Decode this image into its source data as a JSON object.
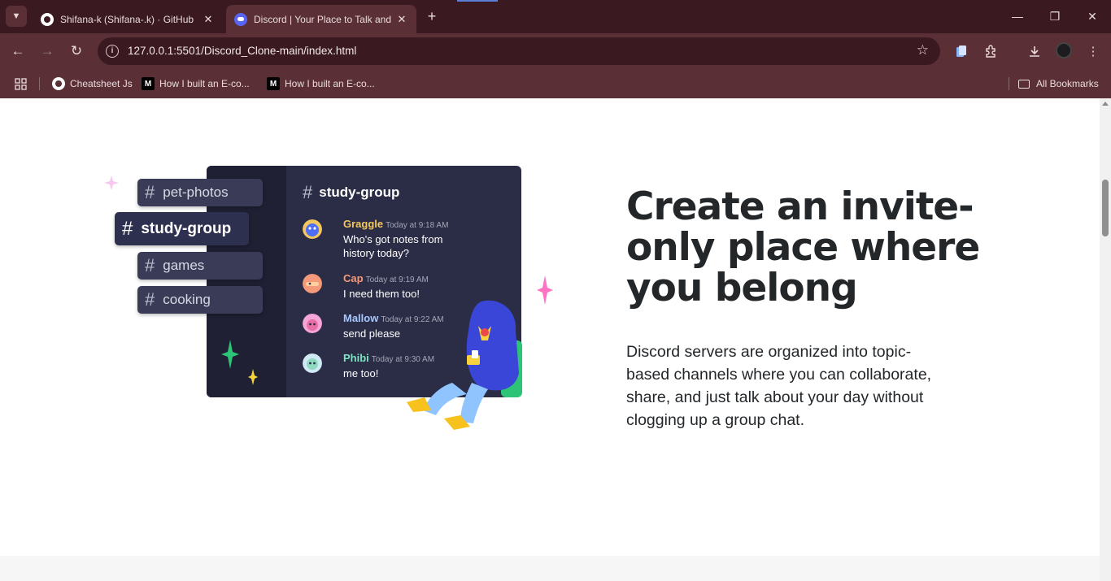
{
  "browser": {
    "tabs": [
      {
        "title": "Shifana-k (Shifana-.k) · GitHub",
        "active": false
      },
      {
        "title": "Discord | Your Place to Talk and",
        "active": true
      }
    ],
    "url": "127.0.0.1:5501/Discord_Clone-main/index.html",
    "bookmarks": [
      {
        "label": "Cheatsheet Js",
        "icon": "github-icon"
      },
      {
        "label": "How I built an E-co...",
        "icon": "medium-icon"
      },
      {
        "label": "How I built an E-co...",
        "icon": "medium-icon"
      }
    ],
    "all_bookmarks_label": "All Bookmarks",
    "icons": {
      "new_tab": "+",
      "close": "✕",
      "back": "←",
      "forward": "→",
      "reload": "↻",
      "star": "☆",
      "menu": "⋮",
      "minimize": "—",
      "maximize": "❐",
      "window_close": "✕"
    }
  },
  "illustration": {
    "channels": [
      "pet-photos",
      "study-group",
      "games",
      "cooking"
    ],
    "active_channel": "study-group",
    "messages": [
      {
        "name": "Graggle",
        "time": "Today at 9:18 AM",
        "text": "Who's got notes from history today?",
        "color": "#f3c75f"
      },
      {
        "name": "Cap",
        "time": "Today at 9:19 AM",
        "text": "I need them too!",
        "color": "#f49a7a"
      },
      {
        "name": "Mallow",
        "time": "Today at 9:22 AM",
        "text": "send please",
        "color": "#a5c8ff"
      },
      {
        "name": "Phibi",
        "time": "Today at 9:30 AM",
        "text": "me too!",
        "color": "#7fe3c4"
      }
    ]
  },
  "section": {
    "headline": "Create an invite-only place where you belong",
    "description": "Discord servers are organized into topic-based channels where you can collaborate, share, and just talk about your day without clogging up a group chat."
  },
  "colors": {
    "chrome_dark": "#3a1a20",
    "chrome": "#5a2f36",
    "blurple": "#5865f2",
    "panel": "#2b2c45",
    "text_dark": "#23272a"
  }
}
